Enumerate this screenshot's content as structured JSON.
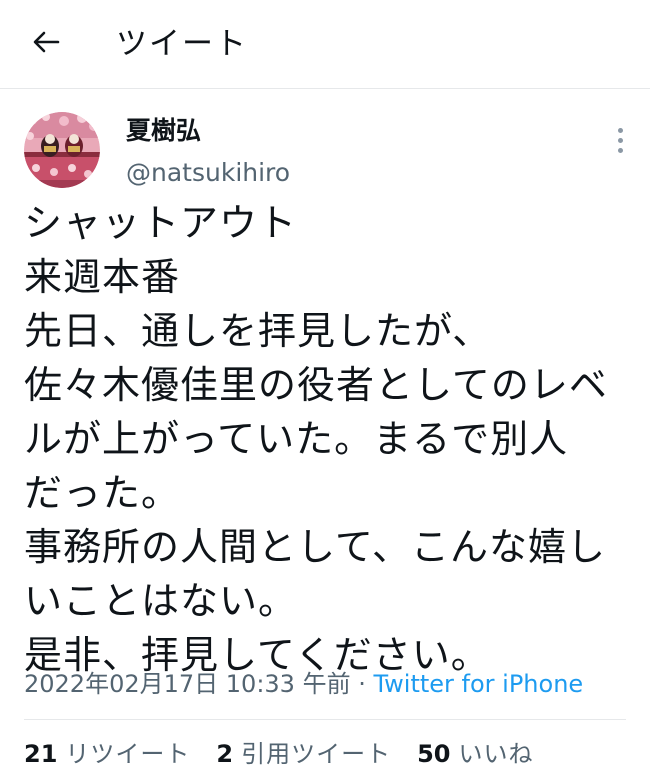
{
  "header": {
    "back_icon": "arrow-left-icon",
    "title": "ツイート"
  },
  "author": {
    "display_name": "夏樹弘",
    "handle": "@natsukihiro",
    "avatar_icon": "hina-doll-avatar"
  },
  "more_icon": "more-vertical-icon",
  "tweet": {
    "lines": [
      "シャットアウト",
      "来週本番",
      "先日、通しを拝見したが、",
      "佐々木優佳里の役者としてのレベ",
      "ルが上がっていた。まるで別人",
      "だった。",
      "事務所の人間として、こんな嬉し",
      "いことはない。",
      "是非、拝見してください。"
    ]
  },
  "meta": {
    "timestamp": "2022年02月17日 10:33 午前",
    "separator": " · ",
    "source": "Twitter for iPhone"
  },
  "stats": {
    "retweets": {
      "count": "21",
      "label": "リツイート"
    },
    "quotes": {
      "count": "2",
      "label": "引用ツイート"
    },
    "likes": {
      "count": "50",
      "label": "いいね"
    }
  },
  "colors": {
    "text": "#0f1419",
    "secondary": "#536471",
    "link": "#1d9bf0",
    "divider": "#e6e8ea"
  }
}
